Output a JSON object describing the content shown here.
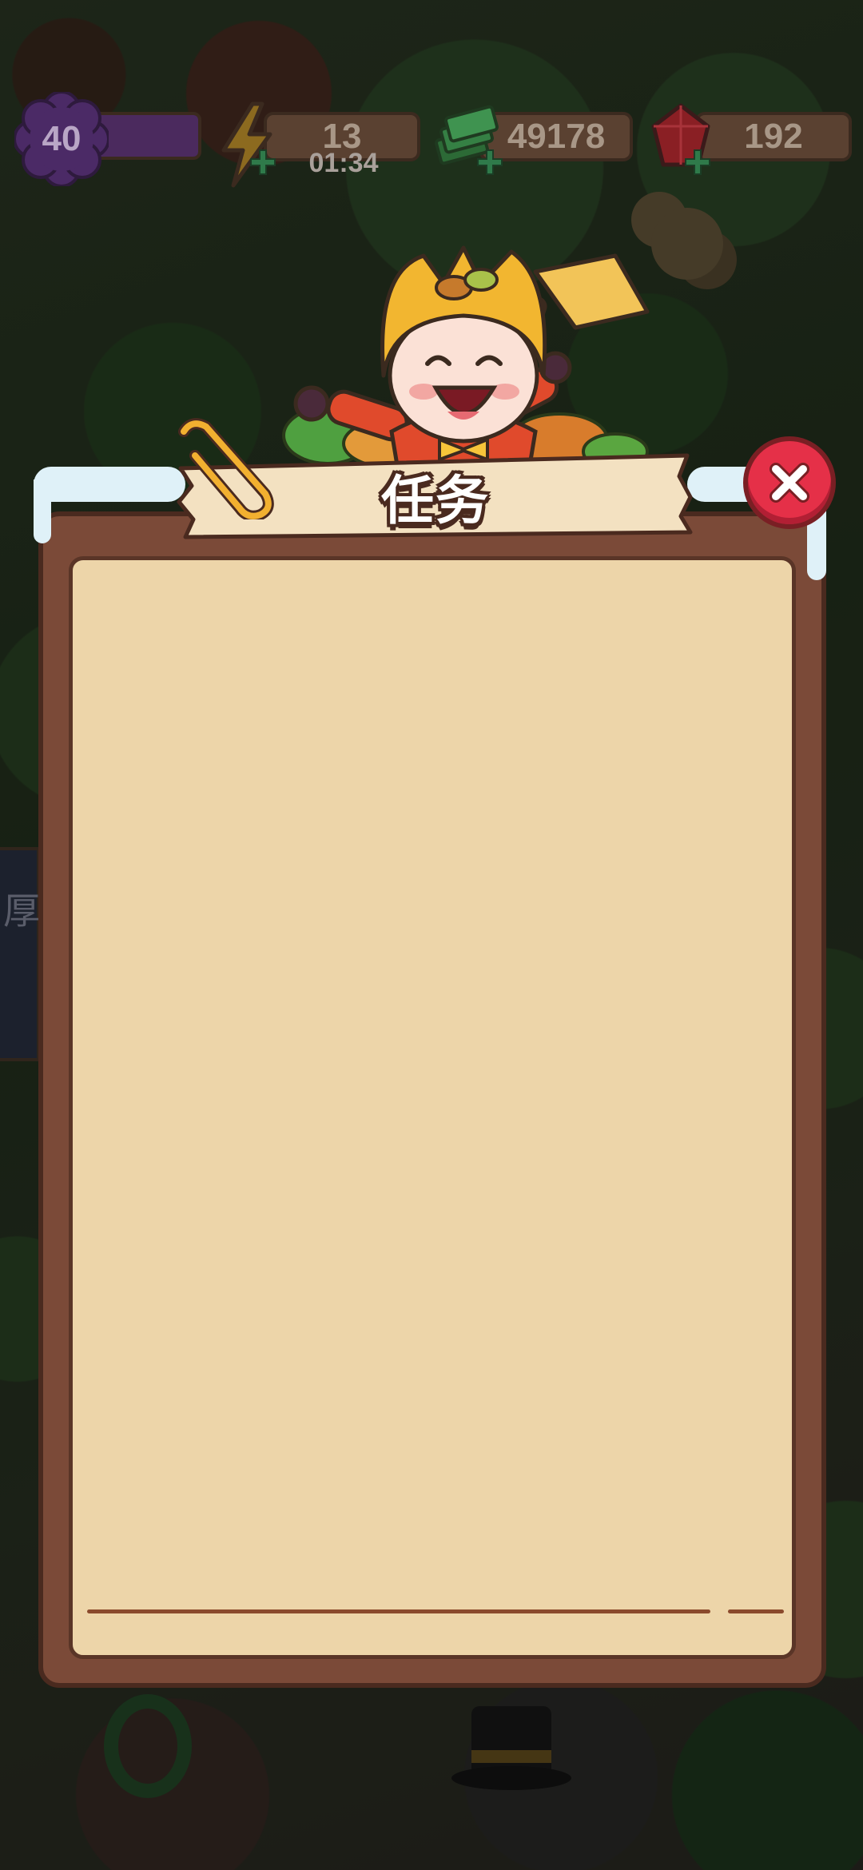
{
  "hud": {
    "level": "40",
    "level_progress": 1.0,
    "energy": "13",
    "energy_timer": "01:34",
    "cash": "49178",
    "gems": "192"
  },
  "task_panel": {
    "title": "任务",
    "tasks": []
  },
  "background": {
    "sign_glyph": "厚"
  },
  "colors": {
    "panel_frame": "#7b4a38",
    "panel_paper": "#edd5a9",
    "close_button": "#e53048",
    "level_badge": "#5b2f79"
  },
  "icons": {
    "level": "flower-badge-icon",
    "energy": "lightning-icon",
    "cash": "cash-stack-icon",
    "gems": "ruby-icon",
    "close": "close-icon",
    "clip": "paperclip-icon"
  }
}
